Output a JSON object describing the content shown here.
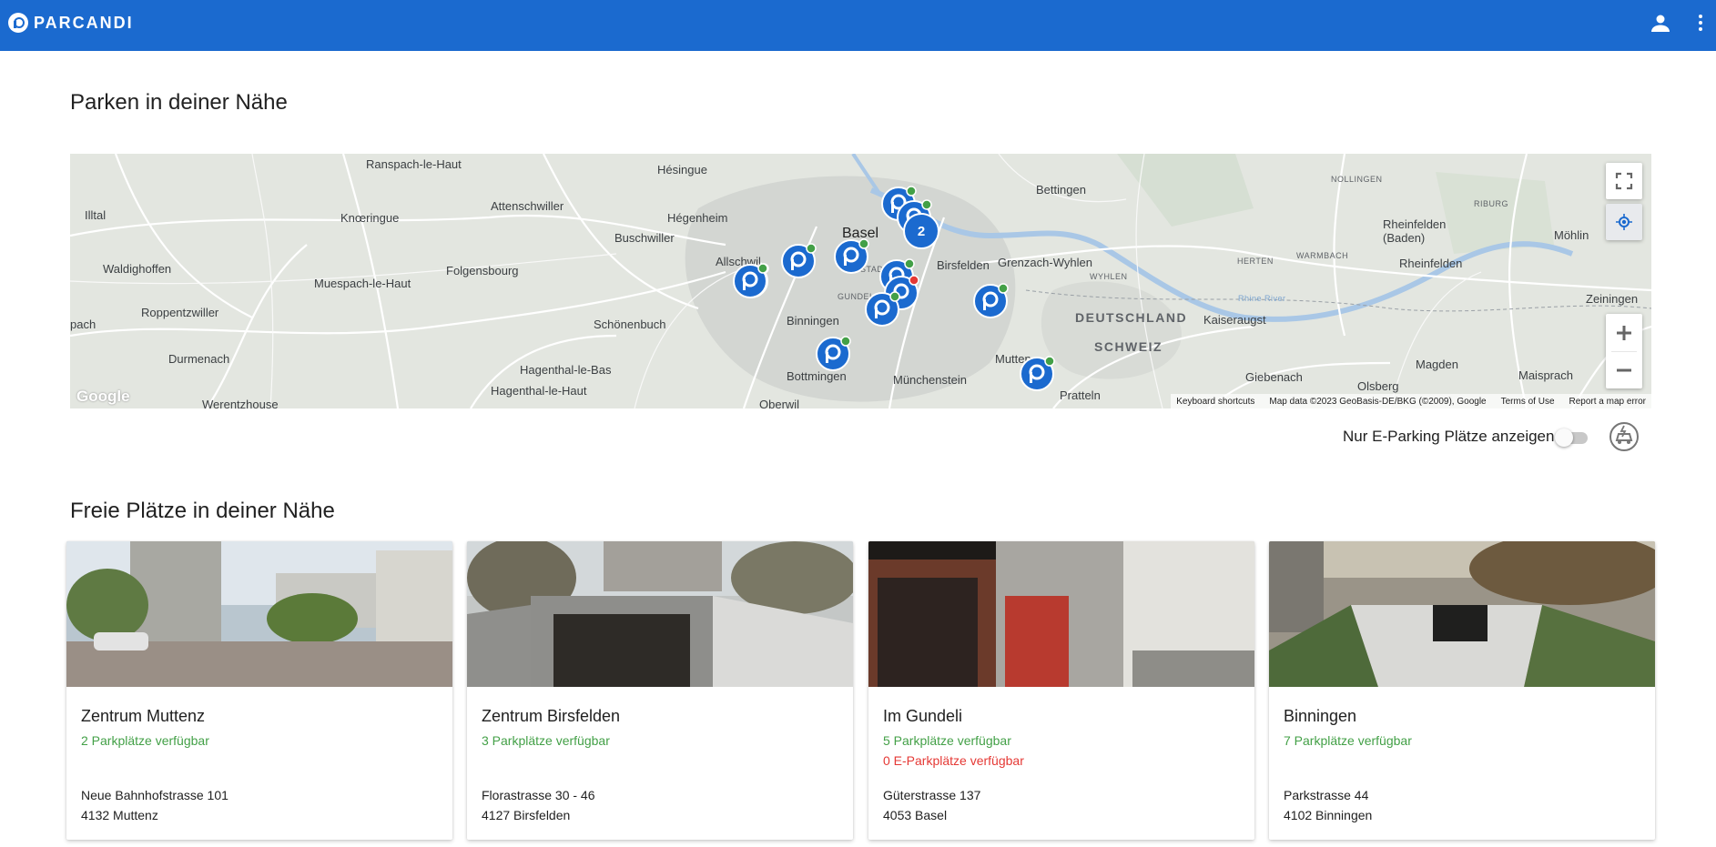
{
  "app": {
    "brand": "PARCANDI",
    "brand_color": "#1b6acf"
  },
  "header": {
    "user_icon": "person-icon",
    "menu_icon": "more-vert-icon"
  },
  "nearby_section": {
    "title": "Parken in deiner Nähe"
  },
  "map": {
    "labels": {
      "ranspach": "Ranspach-le-Haut",
      "hesingue": "Hésingue",
      "attenschwiller": "Attenschwiller",
      "illtal": "Illtal",
      "knoeringue": "Knœringue",
      "hegenheim": "Hégenheim",
      "buschwiller": "Buschwiller",
      "basel": "Basel",
      "waldighoffen": "Waldighoffen",
      "folgensbourg": "Folgensbourg",
      "allschwil": "Allschwil",
      "muespach": "Muespach-le-Haut",
      "roppentzwiller": "Roppentzwiller",
      "pach": "pach",
      "schoenenbuch": "Schönenbuch",
      "binningen": "Binningen",
      "durmenach": "Durmenach",
      "hagenthal_bas": "Hagenthal-le-Bas",
      "hagenthal_haut": "Hagenthal-le-Haut",
      "bottmingen": "Bottmingen",
      "muenchenstein": "Münchenstein",
      "werentzhouse": "Werentzhouse",
      "oberwil": "Oberwil",
      "bettingen": "Bettingen",
      "birsfelden": "Birsfelden",
      "grenzach": "Grenzach-Wyhlen",
      "wyhlen": "WYHLEN",
      "deutschland": "DEUTSCHLAND",
      "schweiz": "SCHWEIZ",
      "kaiseraugst": "Kaiseraugst",
      "muttenz": "Mutten",
      "pratteln": "Pratteln",
      "giebenach": "Giebenach",
      "olsberg": "Olsberg",
      "magden": "Magden",
      "maisprach": "Maisprach",
      "nollingen": "NOLLINGEN",
      "riburg": "RIBURG",
      "rheinfelden_baden": "Rheinfelden\n(Baden)",
      "moehlin": "Möhlin",
      "herten": "HERTEN",
      "warmbach": "WARMBACH",
      "rheinfelden": "Rheinfelden",
      "zeiningen": "Zeiningen",
      "rhine": "Rhine River",
      "gundeli": "GUNDELI",
      "stadt": "STADT"
    },
    "cluster_count": "2",
    "google_logo": "Google",
    "attribution": {
      "shortcuts": "Keyboard shortcuts",
      "data": "Map data ©2023 GeoBasis-DE/BKG (©2009), Google",
      "terms": "Terms of Use",
      "report": "Report a map error"
    }
  },
  "eparking": {
    "label": "Nur E-Parking Plätze anzeigen",
    "enabled": false,
    "icon": "ev-station-icon"
  },
  "free_section": {
    "title": "Freie Plätze in deiner Nähe"
  },
  "cards": [
    {
      "title": "Zentrum Muttenz",
      "availability": "2 Parkplätze verfügbar",
      "e_availability": "",
      "street": "Neue Bahnhofstrasse 101",
      "city": "4132 Muttenz"
    },
    {
      "title": "Zentrum Birsfelden",
      "availability": "3 Parkplätze verfügbar",
      "e_availability": "",
      "street": "Florastrasse 30 - 46",
      "city": "4127 Birsfelden"
    },
    {
      "title": "Im Gundeli",
      "availability": "5 Parkplätze verfügbar",
      "e_availability": "0 E-Parkplätze verfügbar",
      "street": "Güterstrasse 137",
      "city": "4053 Basel"
    },
    {
      "title": "Binningen",
      "availability": "7 Parkplätze verfügbar",
      "e_availability": "",
      "street": "Parkstrasse 44",
      "city": "4102 Binningen"
    }
  ]
}
